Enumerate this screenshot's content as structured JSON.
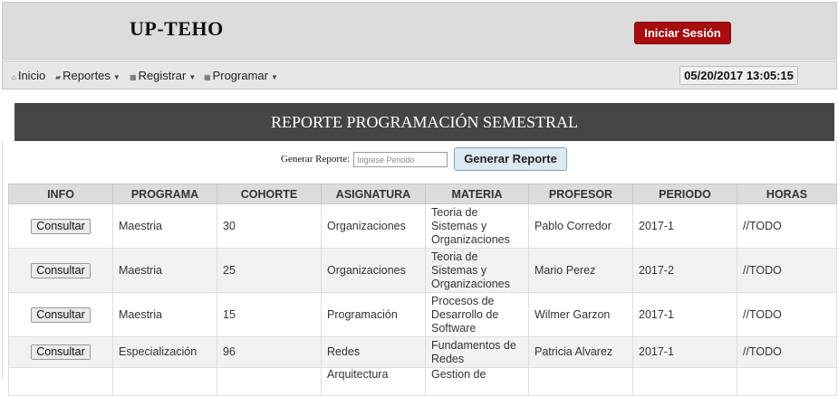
{
  "header": {
    "brand": "UP-TEHO",
    "login_label": "Iniciar Sesión"
  },
  "nav": {
    "items": [
      {
        "label": "Inicio",
        "icon": "home-icon"
      },
      {
        "label": "Reportes",
        "icon": "folder-icon"
      },
      {
        "label": "Registrar",
        "icon": "list-icon"
      },
      {
        "label": "Programar",
        "icon": "list-icon"
      }
    ],
    "datetime": "05/20/2017 13:05:15"
  },
  "banner": {
    "title": "REPORTE PROGRAMACIÓN SEMESTRAL"
  },
  "generate": {
    "label": "Generar Reporte:",
    "placeholder": "Ingrese Periodo",
    "button_label": "Generar Reporte"
  },
  "table": {
    "headers": [
      "INFO",
      "PROGRAMA",
      "COHORTE",
      "ASIGNATURA",
      "MATERIA",
      "PROFESOR",
      "PERIODO",
      "HORAS"
    ],
    "rows": [
      {
        "info": "Consultar",
        "programa": "Maestria",
        "cohorte": "30",
        "asignatura": "Organizaciones",
        "materia": "Teoria de Sistemas y Organizaciones",
        "profesor": "Pablo Corredor",
        "periodo": "2017-1",
        "horas": "//TODO"
      },
      {
        "info": "Consultar",
        "programa": "Maestria",
        "cohorte": "25",
        "asignatura": "Organizaciones",
        "materia": "Teoria de Sistemas y Organizaciones",
        "profesor": "Mario Perez",
        "periodo": "2017-2",
        "horas": "//TODO"
      },
      {
        "info": "Consultar",
        "programa": "Maestria",
        "cohorte": "15",
        "asignatura": "Programación",
        "materia": "Procesos de Desarrollo de Software",
        "profesor": "Wilmer Garzon",
        "periodo": "2017-1",
        "horas": "//TODO"
      },
      {
        "info": "Consultar",
        "programa": "Especialización",
        "cohorte": "96",
        "asignatura": "Redes",
        "materia": "Fundamentos de Redes",
        "profesor": "Patricia Alvarez",
        "periodo": "2017-1",
        "horas": "//TODO"
      },
      {
        "info": "",
        "programa": "",
        "cohorte": "",
        "asignatura": "Arquitectura",
        "materia": "Gestion de",
        "profesor": "",
        "periodo": "",
        "horas": ""
      }
    ]
  }
}
